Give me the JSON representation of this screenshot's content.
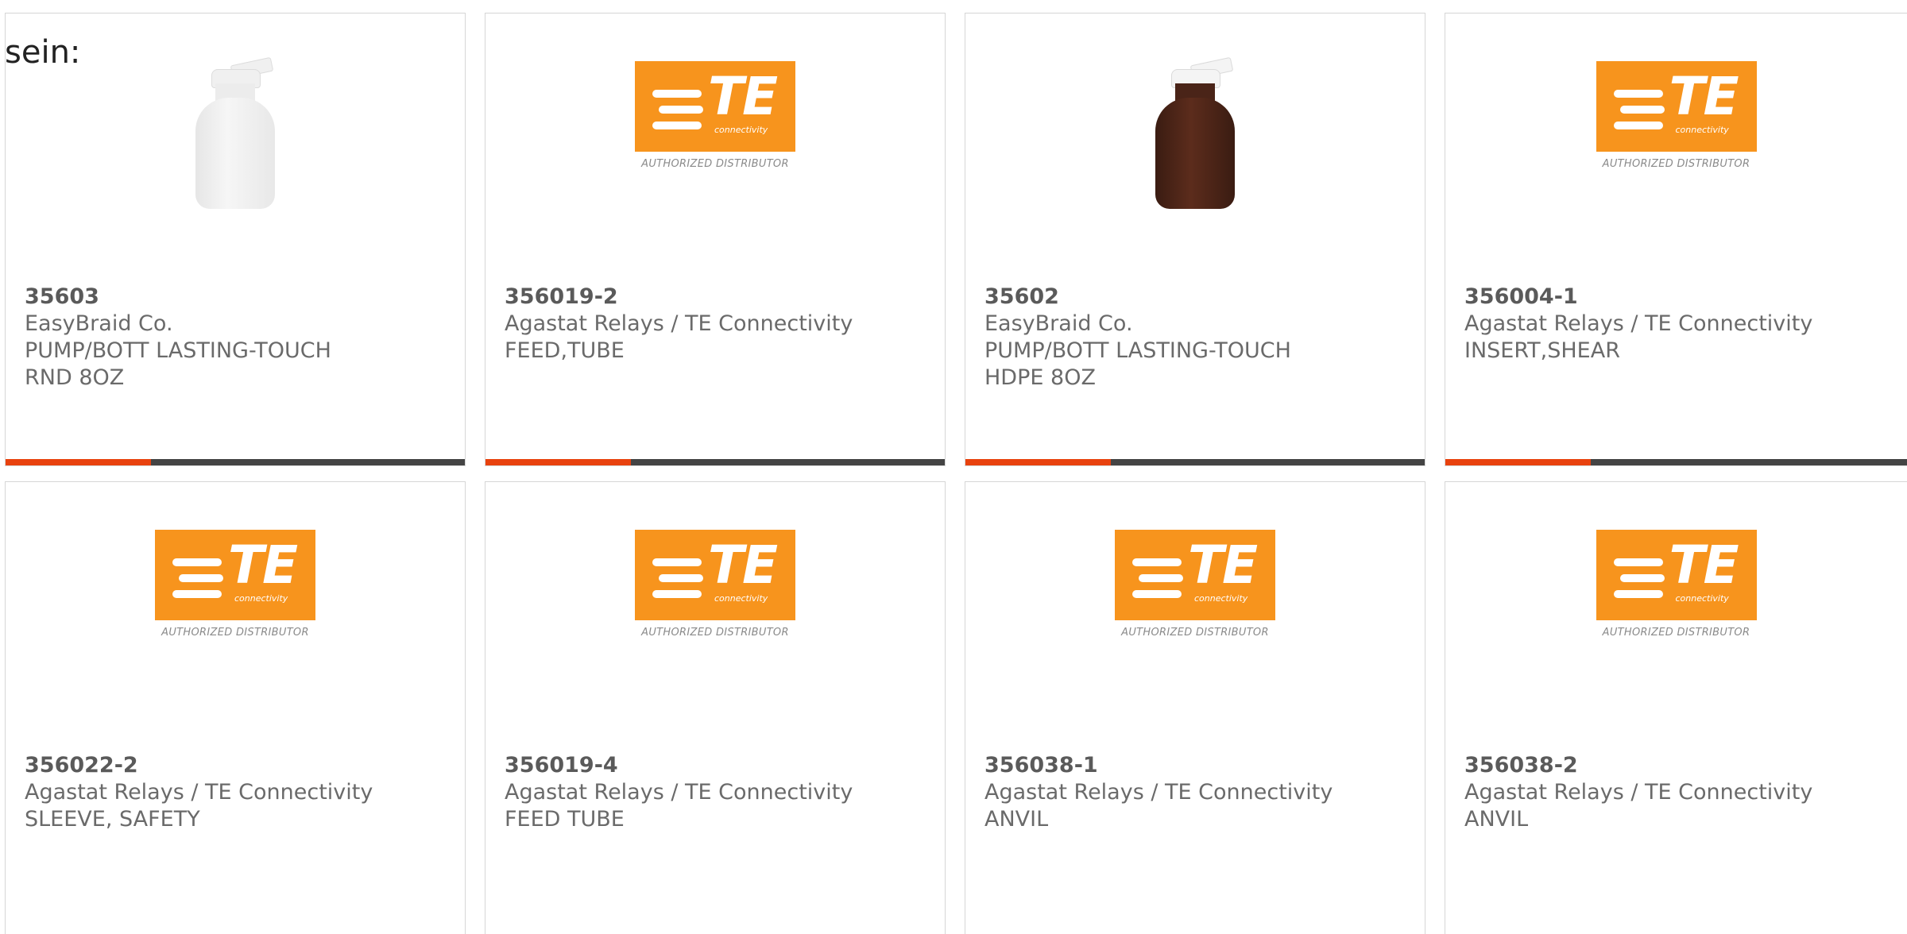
{
  "page": {
    "heading": "sein:"
  },
  "brand": {
    "accent_color": "#e8420e",
    "bar_color": "#444444",
    "te_orange": "#f7941d"
  },
  "logo": {
    "te_text": "TE",
    "te_sub": "connectivity",
    "authorized": "AUTHORIZED DISTRIBUTOR"
  },
  "products": [
    {
      "part": "35603",
      "manufacturer": "EasyBraid Co.",
      "desc1": "PUMP/BOTT LASTING-TOUCH",
      "desc2": "RND 8OZ",
      "image": "white-bottle"
    },
    {
      "part": "356019-2",
      "manufacturer": "Agastat Relays / TE Connectivity",
      "desc1": "FEED,TUBE",
      "desc2": "",
      "image": "te-logo"
    },
    {
      "part": "35602",
      "manufacturer": "EasyBraid Co.",
      "desc1": "PUMP/BOTT LASTING-TOUCH",
      "desc2": "HDPE 8OZ",
      "image": "brown-bottle"
    },
    {
      "part": "356004-1",
      "manufacturer": "Agastat Relays / TE Connectivity",
      "desc1": "INSERT,SHEAR",
      "desc2": "",
      "image": "te-logo"
    },
    {
      "part": "356022-2",
      "manufacturer": "Agastat Relays / TE Connectivity",
      "desc1": "SLEEVE, SAFETY",
      "desc2": "",
      "image": "te-logo"
    },
    {
      "part": "356019-4",
      "manufacturer": "Agastat Relays / TE Connectivity",
      "desc1": "FEED TUBE",
      "desc2": "",
      "image": "te-logo"
    },
    {
      "part": "356038-1",
      "manufacturer": "Agastat Relays / TE Connectivity",
      "desc1": "ANVIL",
      "desc2": "",
      "image": "te-logo"
    },
    {
      "part": "356038-2",
      "manufacturer": "Agastat Relays / TE Connectivity",
      "desc1": "ANVIL",
      "desc2": "",
      "image": "te-logo"
    }
  ]
}
